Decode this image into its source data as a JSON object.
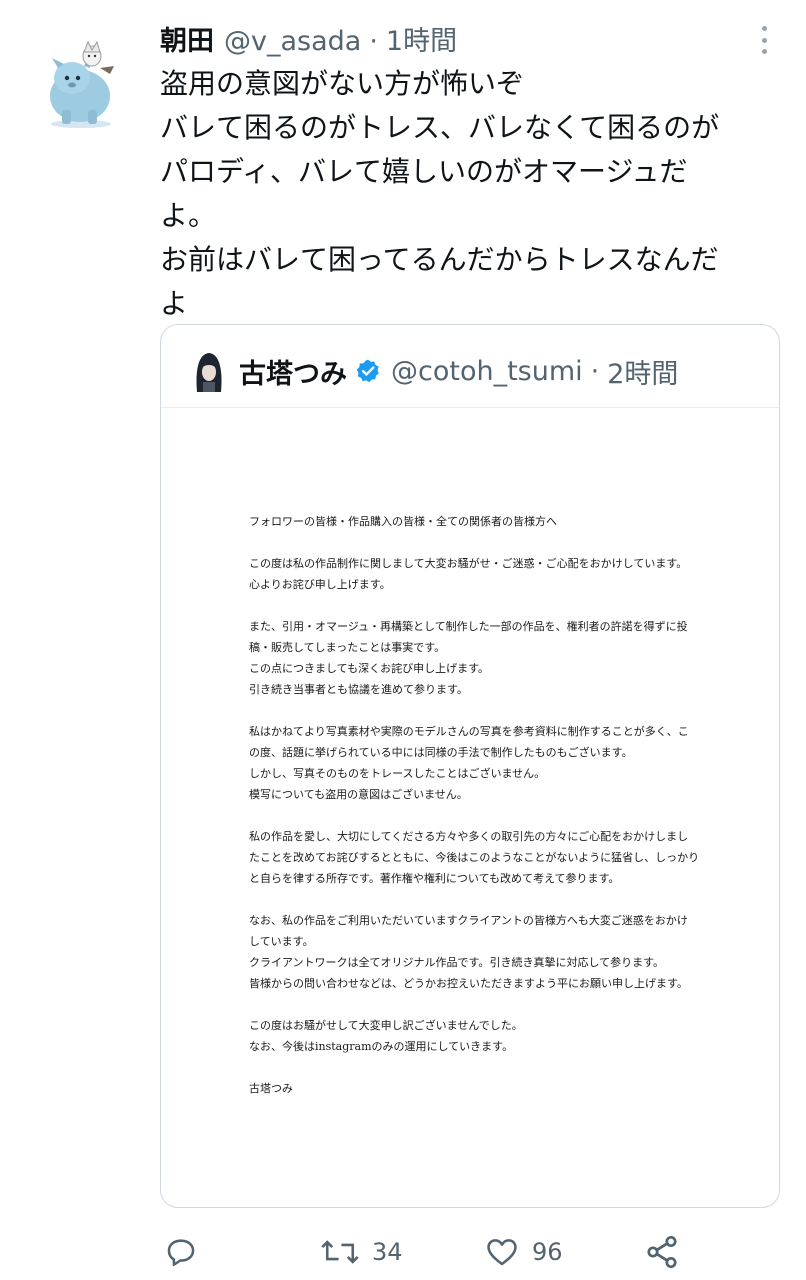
{
  "tweet": {
    "name": "朝田",
    "handle": "@v_asada",
    "separator": "·",
    "time": "1時間",
    "text_lines": [
      "盗用の意図がない方が怖いぞ",
      "バレて困るのがトレス、バレなくて困るのが",
      "パロディ、バレて嬉しいのがオマージュだ",
      "よ。",
      "お前はバレて困ってるんだからトレスなんだ",
      "よ"
    ]
  },
  "quote": {
    "name": "古塔つみ",
    "handle": "@cotoh_tsumi",
    "separator": "·",
    "time": "2時間",
    "letter_paragraphs": [
      [
        "フォロワーの皆様・作品購入の皆様・全ての関係者の皆様方へ"
      ],
      [
        "この度は私の作品制作に関しまして大変お騒がせ・ご迷惑・ご心配をおかけしています。",
        "心よりお詫び申し上げます。"
      ],
      [
        "また、引用・オマージュ・再構築として制作した一部の作品を、権利者の許諾を得ずに投",
        "稿・販売してしまったことは事実です。",
        "この点につきましても深くお詫び申し上げます。",
        "引き続き当事者とも協議を進めて参ります。"
      ],
      [
        "私はかねてより写真素材や実際のモデルさんの写真を参考資料に制作することが多く、こ",
        "の度、話題に挙げられている中には同様の手法で制作したものもございます。",
        "しかし、写真そのものをトレースしたことはございません。",
        "模写についても盗用の意図はございません。"
      ],
      [
        "私の作品を愛し、大切にしてくださる方々や多くの取引先の方々にご心配をおかけしまし",
        "たことを改めてお詫びするとともに、今後はこのようなことがないように猛省し、しっかり",
        "と自らを律する所存です。著作権や権利についても改めて考えて参ります。"
      ],
      [
        "なお、私の作品をご利用いただいていますクライアントの皆様方へも大変ご迷惑をおかけ",
        "しています。",
        "クライアントワークは全てオリジナル作品です。引き続き真摯に対応して参ります。",
        "皆様からの問い合わせなどは、どうかお控えいただきますよう平にお願い申し上げます。"
      ],
      [
        ""
      ],
      [
        "この度はお騒がせして大変申し訳ございませんでした。",
        "なお、今後はinstagramのみの運用にしていきます。"
      ],
      [
        "古塔つみ"
      ]
    ]
  },
  "actions": {
    "reply_icon": "reply-icon",
    "retweet_icon": "retweet-icon",
    "retweet_count": "34",
    "like_icon": "heart-icon",
    "like_count": "96",
    "share_icon": "share-icon"
  },
  "colors": {
    "text": "#0f1419",
    "secondary": "#536471",
    "border": "#cfd9de",
    "verified": "#1d9bf0"
  }
}
